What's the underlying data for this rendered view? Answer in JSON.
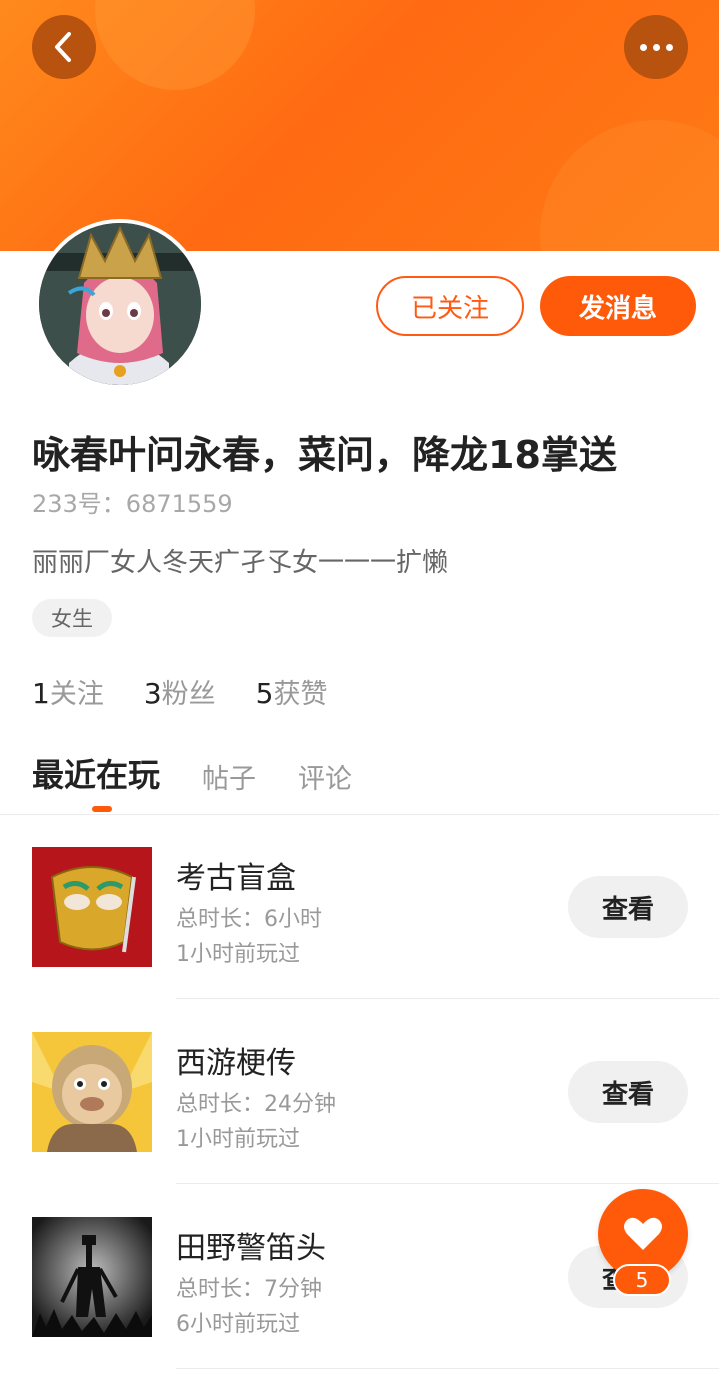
{
  "profile": {
    "name": "咏春叶问永春，菜问，降龙18掌送",
    "uid_label": "233号：6871559",
    "bio": "丽丽厂女人冬天疒孑孓女一一一扩懒",
    "gender_tag": "女生"
  },
  "actions": {
    "followed_label": "已关注",
    "message_label": "发消息"
  },
  "stats": [
    {
      "num": "1",
      "label": "关注"
    },
    {
      "num": "3",
      "label": "粉丝"
    },
    {
      "num": "5",
      "label": "获赞"
    }
  ],
  "tabs": [
    {
      "label": "最近在玩",
      "active": true
    },
    {
      "label": "帖子",
      "active": false
    },
    {
      "label": "评论",
      "active": false
    }
  ],
  "games": [
    {
      "title": "考古盲盒",
      "duration": "总时长：6小时",
      "last_played": "1小时前玩过",
      "view_label": "查看"
    },
    {
      "title": "西游梗传",
      "duration": "总时长：24分钟",
      "last_played": "1小时前玩过",
      "view_label": "查看"
    },
    {
      "title": "田野警笛头",
      "duration": "总时长：7分钟",
      "last_played": "6小时前玩过",
      "view_label": "查看"
    }
  ],
  "like_fab": {
    "count": "5"
  },
  "colors": {
    "accent": "#ff5a0a",
    "banner": "#ff7a16"
  }
}
